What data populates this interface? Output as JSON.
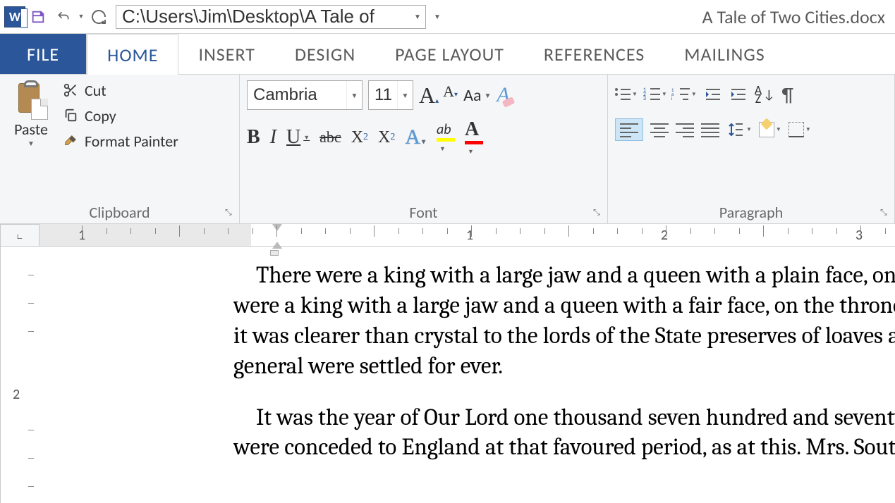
{
  "titlebar": {
    "path": "C:\\Users\\Jim\\Desktop\\A Tale of",
    "doc_title": "A Tale of Two Cities.docx"
  },
  "tabs": {
    "file": "FILE",
    "home": "HOME",
    "insert": "INSERT",
    "design": "DESIGN",
    "page_layout": "PAGE LAYOUT",
    "references": "REFERENCES",
    "mailings": "MAILINGS"
  },
  "clipboard": {
    "paste": "Paste",
    "cut": "Cut",
    "copy": "Copy",
    "format_painter": "Format Painter",
    "label": "Clipboard"
  },
  "font": {
    "name": "Cambria",
    "size": "11",
    "case": "Aa",
    "label": "Font"
  },
  "paragraph": {
    "label": "Paragraph"
  },
  "ruler": {
    "n1": "1",
    "n2": "1",
    "n3": "2",
    "n4": "3"
  },
  "vruler": {
    "n2": "2"
  },
  "body": {
    "p1": "There were a king with a large jaw and a queen with a plain face, on the",
    "p1b": "were a king with a large jaw and a queen with a fair face, on the throne of",
    "p1c": "it was clearer than crystal to the lords of the State preserves of loaves and",
    "p1d": "general were settled for ever.",
    "p2": "It was the year of Our Lord one thousand seven hundred and seventy-five.",
    "p2b": "were conceded to England at that favoured period, as at this. Mrs. Southcott"
  }
}
